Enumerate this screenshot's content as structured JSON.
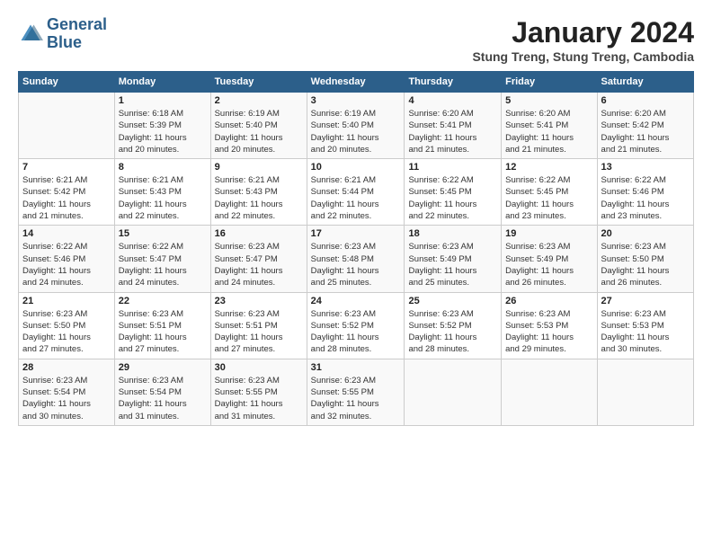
{
  "logo": {
    "line1": "General",
    "line2": "Blue"
  },
  "title": "January 2024",
  "subtitle": "Stung Treng, Stung Treng, Cambodia",
  "weekdays": [
    "Sunday",
    "Monday",
    "Tuesday",
    "Wednesday",
    "Thursday",
    "Friday",
    "Saturday"
  ],
  "weeks": [
    [
      {
        "num": "",
        "info": ""
      },
      {
        "num": "1",
        "info": "Sunrise: 6:18 AM\nSunset: 5:39 PM\nDaylight: 11 hours\nand 20 minutes."
      },
      {
        "num": "2",
        "info": "Sunrise: 6:19 AM\nSunset: 5:40 PM\nDaylight: 11 hours\nand 20 minutes."
      },
      {
        "num": "3",
        "info": "Sunrise: 6:19 AM\nSunset: 5:40 PM\nDaylight: 11 hours\nand 20 minutes."
      },
      {
        "num": "4",
        "info": "Sunrise: 6:20 AM\nSunset: 5:41 PM\nDaylight: 11 hours\nand 21 minutes."
      },
      {
        "num": "5",
        "info": "Sunrise: 6:20 AM\nSunset: 5:41 PM\nDaylight: 11 hours\nand 21 minutes."
      },
      {
        "num": "6",
        "info": "Sunrise: 6:20 AM\nSunset: 5:42 PM\nDaylight: 11 hours\nand 21 minutes."
      }
    ],
    [
      {
        "num": "7",
        "info": "Sunrise: 6:21 AM\nSunset: 5:42 PM\nDaylight: 11 hours\nand 21 minutes."
      },
      {
        "num": "8",
        "info": "Sunrise: 6:21 AM\nSunset: 5:43 PM\nDaylight: 11 hours\nand 22 minutes."
      },
      {
        "num": "9",
        "info": "Sunrise: 6:21 AM\nSunset: 5:43 PM\nDaylight: 11 hours\nand 22 minutes."
      },
      {
        "num": "10",
        "info": "Sunrise: 6:21 AM\nSunset: 5:44 PM\nDaylight: 11 hours\nand 22 minutes."
      },
      {
        "num": "11",
        "info": "Sunrise: 6:22 AM\nSunset: 5:45 PM\nDaylight: 11 hours\nand 22 minutes."
      },
      {
        "num": "12",
        "info": "Sunrise: 6:22 AM\nSunset: 5:45 PM\nDaylight: 11 hours\nand 23 minutes."
      },
      {
        "num": "13",
        "info": "Sunrise: 6:22 AM\nSunset: 5:46 PM\nDaylight: 11 hours\nand 23 minutes."
      }
    ],
    [
      {
        "num": "14",
        "info": "Sunrise: 6:22 AM\nSunset: 5:46 PM\nDaylight: 11 hours\nand 24 minutes."
      },
      {
        "num": "15",
        "info": "Sunrise: 6:22 AM\nSunset: 5:47 PM\nDaylight: 11 hours\nand 24 minutes."
      },
      {
        "num": "16",
        "info": "Sunrise: 6:23 AM\nSunset: 5:47 PM\nDaylight: 11 hours\nand 24 minutes."
      },
      {
        "num": "17",
        "info": "Sunrise: 6:23 AM\nSunset: 5:48 PM\nDaylight: 11 hours\nand 25 minutes."
      },
      {
        "num": "18",
        "info": "Sunrise: 6:23 AM\nSunset: 5:49 PM\nDaylight: 11 hours\nand 25 minutes."
      },
      {
        "num": "19",
        "info": "Sunrise: 6:23 AM\nSunset: 5:49 PM\nDaylight: 11 hours\nand 26 minutes."
      },
      {
        "num": "20",
        "info": "Sunrise: 6:23 AM\nSunset: 5:50 PM\nDaylight: 11 hours\nand 26 minutes."
      }
    ],
    [
      {
        "num": "21",
        "info": "Sunrise: 6:23 AM\nSunset: 5:50 PM\nDaylight: 11 hours\nand 27 minutes."
      },
      {
        "num": "22",
        "info": "Sunrise: 6:23 AM\nSunset: 5:51 PM\nDaylight: 11 hours\nand 27 minutes."
      },
      {
        "num": "23",
        "info": "Sunrise: 6:23 AM\nSunset: 5:51 PM\nDaylight: 11 hours\nand 27 minutes."
      },
      {
        "num": "24",
        "info": "Sunrise: 6:23 AM\nSunset: 5:52 PM\nDaylight: 11 hours\nand 28 minutes."
      },
      {
        "num": "25",
        "info": "Sunrise: 6:23 AM\nSunset: 5:52 PM\nDaylight: 11 hours\nand 28 minutes."
      },
      {
        "num": "26",
        "info": "Sunrise: 6:23 AM\nSunset: 5:53 PM\nDaylight: 11 hours\nand 29 minutes."
      },
      {
        "num": "27",
        "info": "Sunrise: 6:23 AM\nSunset: 5:53 PM\nDaylight: 11 hours\nand 30 minutes."
      }
    ],
    [
      {
        "num": "28",
        "info": "Sunrise: 6:23 AM\nSunset: 5:54 PM\nDaylight: 11 hours\nand 30 minutes."
      },
      {
        "num": "29",
        "info": "Sunrise: 6:23 AM\nSunset: 5:54 PM\nDaylight: 11 hours\nand 31 minutes."
      },
      {
        "num": "30",
        "info": "Sunrise: 6:23 AM\nSunset: 5:55 PM\nDaylight: 11 hours\nand 31 minutes."
      },
      {
        "num": "31",
        "info": "Sunrise: 6:23 AM\nSunset: 5:55 PM\nDaylight: 11 hours\nand 32 minutes."
      },
      {
        "num": "",
        "info": ""
      },
      {
        "num": "",
        "info": ""
      },
      {
        "num": "",
        "info": ""
      }
    ]
  ]
}
